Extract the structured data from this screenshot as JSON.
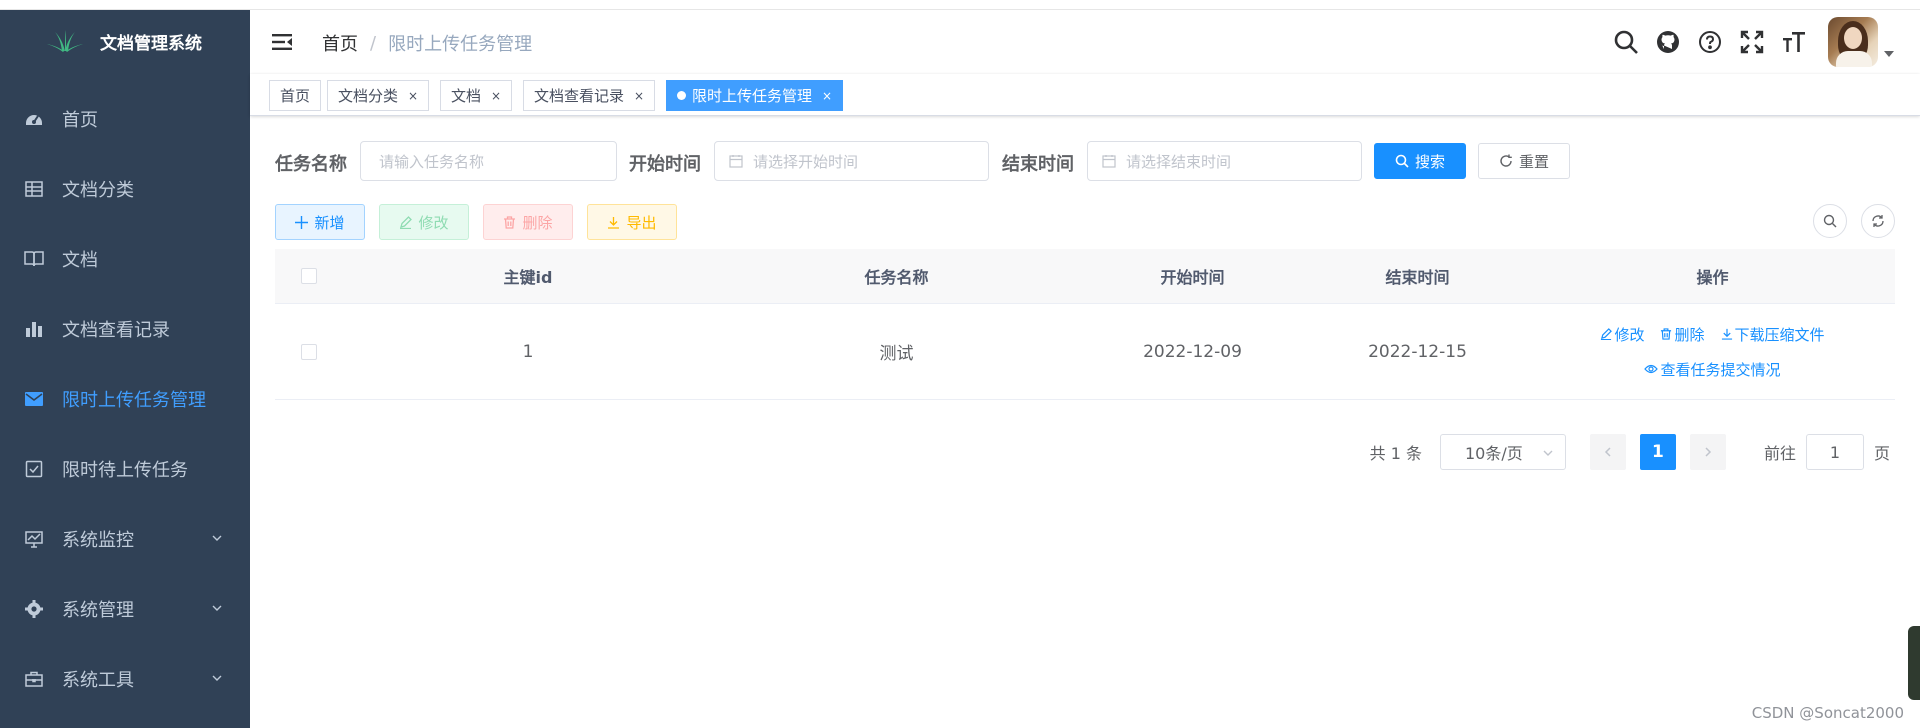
{
  "app": {
    "title": "文档管理系统"
  },
  "sidebar": {
    "items": [
      {
        "label": "首页",
        "icon": "dashboard-icon",
        "active": false
      },
      {
        "label": "文档分类",
        "icon": "table-icon",
        "active": false
      },
      {
        "label": "文档",
        "icon": "book-icon",
        "active": false
      },
      {
        "label": "文档查看记录",
        "icon": "bar-chart-icon",
        "active": false
      },
      {
        "label": "限时上传任务管理",
        "icon": "mail-icon",
        "active": true
      },
      {
        "label": "限时待上传任务",
        "icon": "checkbox-icon",
        "active": false
      },
      {
        "label": "系统监控",
        "icon": "monitor-icon",
        "active": false,
        "has_children": true
      },
      {
        "label": "系统管理",
        "icon": "gear-icon",
        "active": false,
        "has_children": true
      },
      {
        "label": "系统工具",
        "icon": "toolbox-icon",
        "active": false,
        "has_children": true
      }
    ],
    "accent": "#409eff",
    "background": "#304156"
  },
  "navbar": {
    "breadcrumb": {
      "home": "首页",
      "separator": "/",
      "current": "限时上传任务管理"
    }
  },
  "tags": [
    {
      "label": "首页",
      "closable": false,
      "active": false
    },
    {
      "label": "文档分类",
      "closable": true,
      "active": false
    },
    {
      "label": "文档",
      "closable": true,
      "active": false
    },
    {
      "label": "文档查看记录",
      "closable": true,
      "active": false
    },
    {
      "label": "限时上传任务管理",
      "closable": true,
      "active": true
    }
  ],
  "close_glyph": "×",
  "search": {
    "task_name_label": "任务名称",
    "task_name_placeholder": "请输入任务名称",
    "start_label": "开始时间",
    "start_placeholder": "请选择开始时间",
    "end_label": "结束时间",
    "end_placeholder": "请选择结束时间",
    "search_button": "搜索",
    "reset_button": "重置"
  },
  "toolbar": {
    "add": "新增",
    "edit": "修改",
    "delete": "删除",
    "export": "导出"
  },
  "table": {
    "columns": [
      "主键id",
      "任务名称",
      "开始时间",
      "结束时间",
      "操作"
    ],
    "rows": [
      {
        "id": "1",
        "name": "测试",
        "start": "2022-12-09",
        "end": "2022-12-15"
      }
    ],
    "actions": {
      "edit": "修改",
      "delete": "删除",
      "download": "下载压缩文件",
      "view": "查看任务提交情况"
    }
  },
  "pagination": {
    "total": "共 1 条",
    "page_size": "10条/页",
    "current_page": "1",
    "goto_prefix": "前往",
    "goto_value": "1",
    "goto_suffix": "页"
  },
  "watermark": "CSDN @Soncat2000"
}
